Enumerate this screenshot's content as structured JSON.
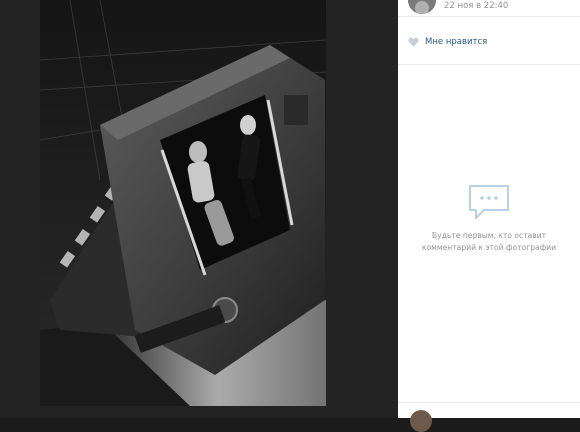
{
  "post": {
    "date": "22 ноя в 22:40"
  },
  "likes": {
    "label": "Мне нравится"
  },
  "comments": {
    "empty_line1": "Будьте первым, кто оставит",
    "empty_line2": "комментарий к этой фотографии"
  },
  "colors": {
    "link": "#2a5885",
    "muted": "#939393",
    "icon": "#b8d0e4",
    "heart": "#c5d0db"
  },
  "icons": {
    "like": "heart-icon",
    "comments_empty": "speech-bubble-icon"
  }
}
